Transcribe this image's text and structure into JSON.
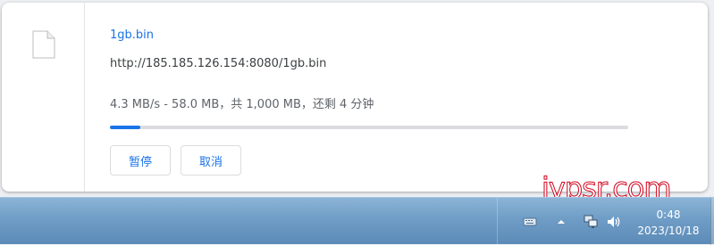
{
  "download": {
    "filename": "1gb.bin",
    "url": "http://185.185.126.154:8080/1gb.bin",
    "status": "4.3 MB/s - 58.0 MB，共 1,000 MB，还剩 4 分钟",
    "progress_fraction": 0.058,
    "pause_label": "暂停",
    "cancel_label": "取消",
    "file_icon": "file-icon"
  },
  "watermark": {
    "text": "ivpsr.com"
  },
  "taskbar": {
    "tray_icons": [
      "keyboard-icon",
      "chevron-up-icon",
      "network-icon",
      "speaker-icon"
    ],
    "clock_time": "0:48",
    "clock_date": "2023/10/18"
  },
  "colors": {
    "accent": "#1a73e8",
    "progress_track": "#dadce0",
    "taskbar": "#6f9dc6",
    "watermark_stroke": "#d0021b"
  }
}
